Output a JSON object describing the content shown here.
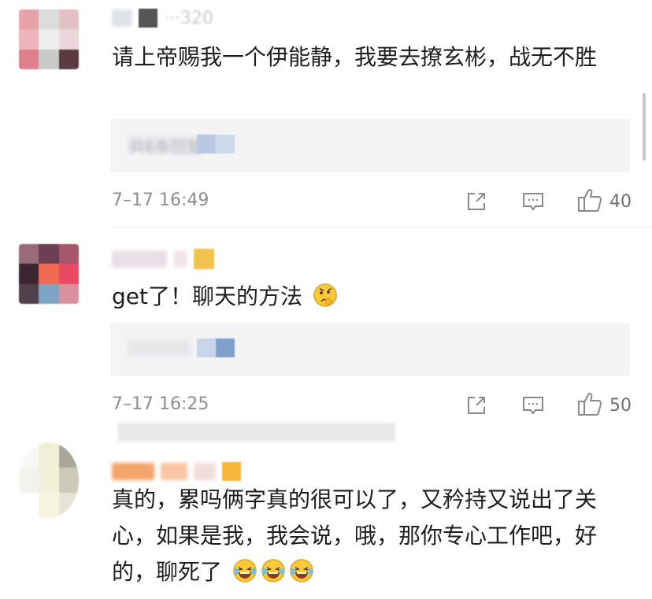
{
  "comments": [
    {
      "username": "···320",
      "text": "请上帝赐我一个伊能静，我要去撩玄彬，战无不胜",
      "time": "7–17 16:49",
      "likes": "40",
      "replies_preview": "共6条回复"
    },
    {
      "username": "",
      "text": "get了！聊天的方法",
      "time": "7–17 16:25",
      "likes": "50",
      "replies_preview": ""
    },
    {
      "username": "",
      "text": "真的，累吗俩字真的很可以了，又矜持又说出了关心，如果是我，我会说，哦，那你专心工作吧，好的，聊死了",
      "time": "",
      "likes": "",
      "replies_preview": ""
    }
  ],
  "icons": {
    "share": "share-icon",
    "reply": "comment-icon",
    "like": "thumbs-up-icon",
    "thinking": "thinking-emoji-icon",
    "laugh": "laughing-tears-emoji-icon"
  },
  "colors": {
    "background": "#ffffff",
    "text": "#1e1e1e",
    "meta": "#8d8d92",
    "reply_box": "#f4f4f5",
    "divider": "#ececee"
  }
}
